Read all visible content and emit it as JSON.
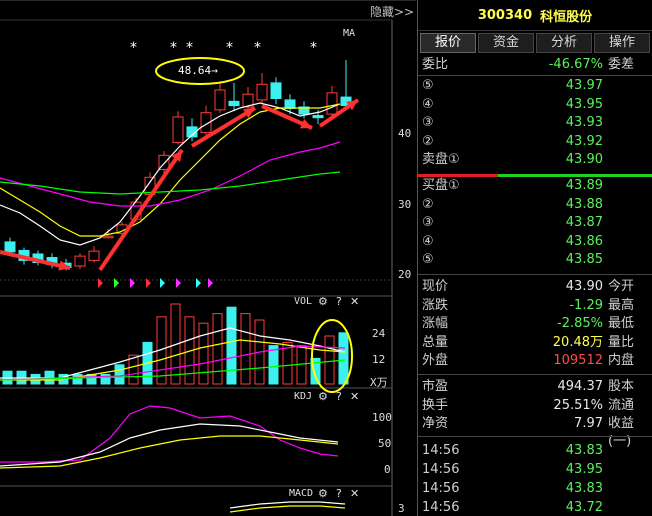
{
  "toolbar": {
    "hide_label": "隐藏>>"
  },
  "chart": {
    "ma_label": "MA",
    "callout": "48.64→",
    "price_ticks": [
      "40",
      "30",
      "20"
    ],
    "vol": {
      "title": "VOL",
      "ticks": [
        "24",
        "12"
      ],
      "unit": "X万"
    },
    "kdj": {
      "title": "KDJ",
      "ticks": [
        "100",
        "50",
        "0"
      ]
    },
    "macd": {
      "title": "MACD",
      "ticks": [
        "3"
      ]
    },
    "colors": {
      "up": "#ff3c3c",
      "down": "#3cf0f0",
      "ma5": "#ffffff",
      "ma10": "#ffff00",
      "ma20": "#ff00ff",
      "ma60": "#00ff00",
      "arrow": "#ff3030",
      "callout": "#ffff00"
    }
  },
  "panel": {
    "code": "300340",
    "name": "科恒股份",
    "tabs": [
      "报价",
      "资金",
      "分析",
      "操作"
    ],
    "weibi": {
      "label": "委比",
      "value": "-46.67%",
      "unit": "委差"
    },
    "asks": [
      {
        "label": "⑤",
        "price": "43.97"
      },
      {
        "label": "④",
        "price": "43.95"
      },
      {
        "label": "③",
        "price": "43.93"
      },
      {
        "label": "②",
        "price": "43.92"
      },
      {
        "label": "卖盘①",
        "price": "43.90"
      }
    ],
    "bids": [
      {
        "label": "买盘①",
        "price": "43.89"
      },
      {
        "label": "②",
        "price": "43.88"
      },
      {
        "label": "③",
        "price": "43.87"
      },
      {
        "label": "④",
        "price": "43.86"
      },
      {
        "label": "⑤",
        "price": "43.85"
      }
    ],
    "quote": [
      {
        "label": "现价",
        "value": "43.90",
        "unit": "今开",
        "color": "white"
      },
      {
        "label": "涨跌",
        "value": "-1.29",
        "unit": "最高",
        "color": "green"
      },
      {
        "label": "涨幅",
        "value": "-2.85%",
        "unit": "最低",
        "color": "green"
      },
      {
        "label": "总量",
        "value": "20.48万",
        "unit": "量比",
        "color": "yellow"
      },
      {
        "label": "外盘",
        "value": "109512",
        "unit": "内盘",
        "color": "red"
      }
    ],
    "fund": [
      {
        "label": "市盈",
        "value": "494.37",
        "unit": "股本"
      },
      {
        "label": "换手",
        "value": "25.51%",
        "unit": "流通"
      },
      {
        "label": "净资",
        "value": "7.97",
        "unit": "收益(一)"
      }
    ],
    "ticks": [
      {
        "time": "14:56",
        "price": "43.83"
      },
      {
        "time": "14:56",
        "price": "43.95"
      },
      {
        "time": "14:56",
        "price": "43.83"
      },
      {
        "time": "14:56",
        "price": "43.72"
      }
    ]
  }
}
